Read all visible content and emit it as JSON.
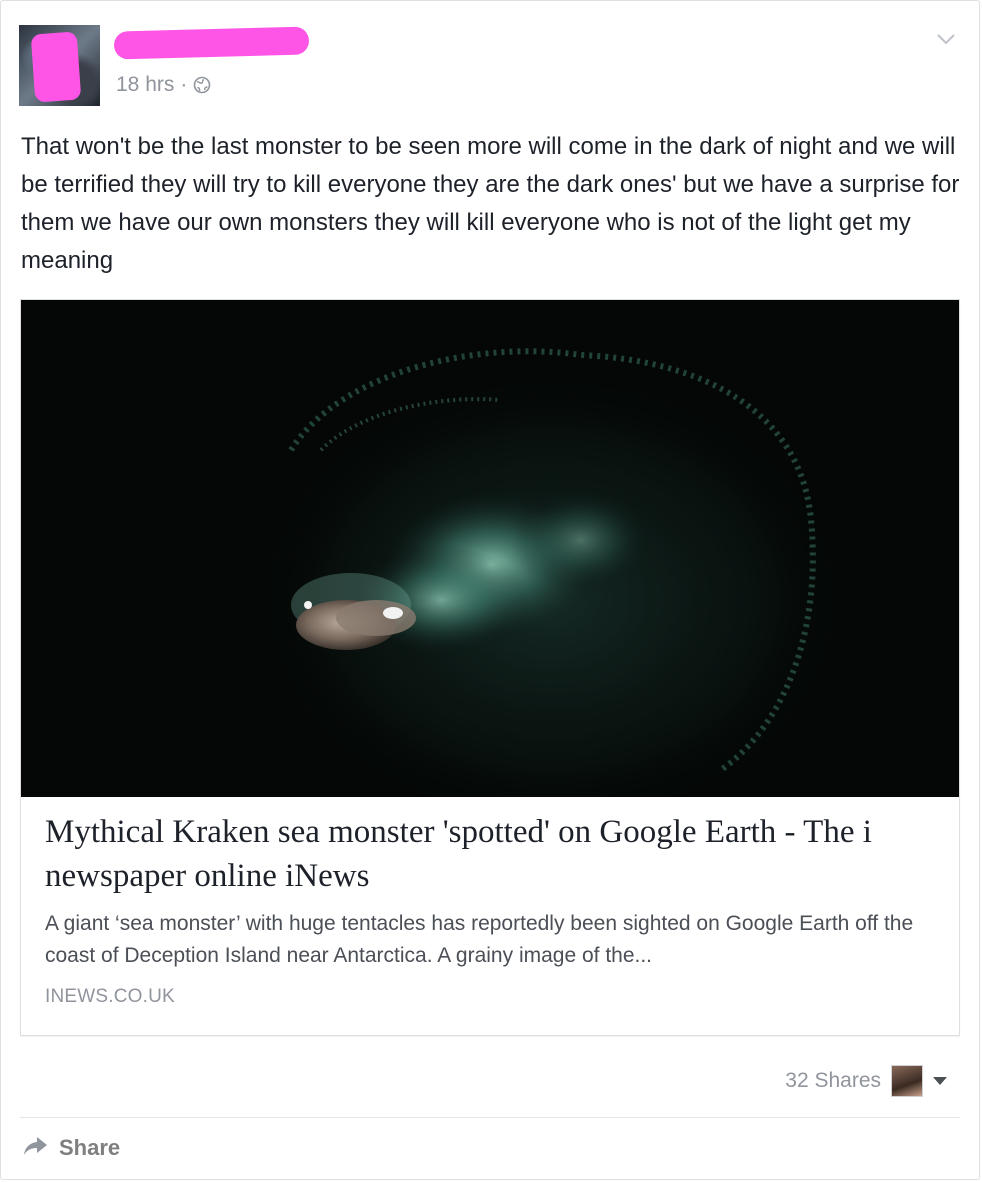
{
  "post": {
    "timestamp": "18 hrs",
    "separator": "·",
    "privacy_icon": "globe-icon",
    "menu_icon": "chevron-down-icon",
    "text": "That won't be the last monster to be seen more will come in the dark of night and we will be terrified they will try to kill everyone they are the dark ones' but we have a surprise for them we have our own monsters they will kill everyone who is not of the light get my meaning"
  },
  "link": {
    "title": "Mythical Kraken sea monster 'spotted' on Google Earth - The i newspaper online iNews",
    "description": "A giant ‘sea monster’ with huge tentacles has reportedly been sighted on Google Earth off the coast of Deception Island near Antarctica. A grainy image of the...",
    "domain": "INEWS.CO.UK"
  },
  "footer": {
    "shares": "32 Shares",
    "share_label": "Share",
    "share_icon": "share-arrow-icon"
  },
  "colors": {
    "redaction": "#ff55e6",
    "muted_text": "#90949c",
    "body_text": "#1d2129"
  }
}
